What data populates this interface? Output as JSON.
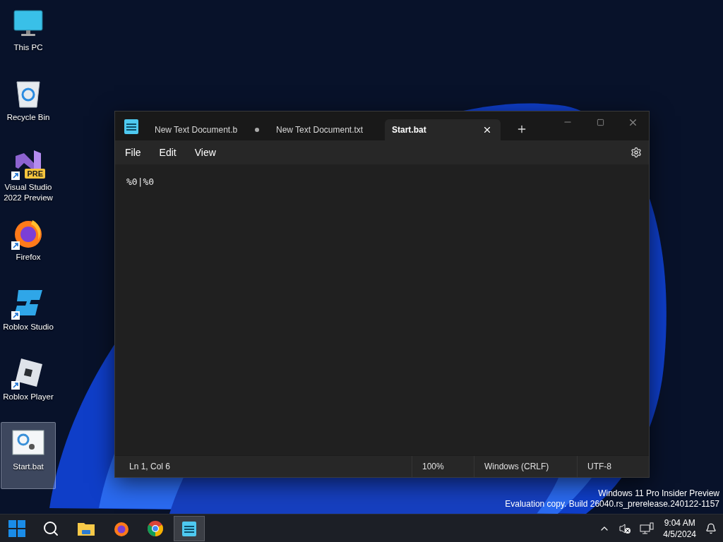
{
  "desktop_icons": [
    {
      "kind": "monitor",
      "label": "This PC",
      "selected": false
    },
    {
      "kind": "recycle-bin",
      "label": "Recycle Bin",
      "selected": false
    },
    {
      "kind": "visual-studio",
      "label": "Visual Studio 2022 Preview",
      "badge": "PRE",
      "shortcut": true,
      "selected": false
    },
    {
      "kind": "firefox",
      "label": "Firefox",
      "shortcut": true,
      "selected": false
    },
    {
      "kind": "roblox-studio",
      "label": "Roblox Studio",
      "shortcut": true,
      "selected": false
    },
    {
      "kind": "roblox-player",
      "label": "Roblox Player",
      "shortcut": true,
      "selected": false
    },
    {
      "kind": "batch-file",
      "label": "Start.bat",
      "selected": true
    }
  ],
  "window": {
    "tabs": [
      {
        "title": "New Text Document.b",
        "unsaved": true,
        "selected": false
      },
      {
        "title": "New Text Document.txt",
        "unsaved": false,
        "selected": false
      },
      {
        "title": "Start.bat",
        "unsaved": false,
        "selected": true
      }
    ],
    "menu": [
      "File",
      "Edit",
      "View"
    ],
    "content": "%0|%0",
    "status_bar": [
      "Ln 1, Col 6",
      "100%",
      "Windows (CRLF)",
      "UTF-8"
    ]
  },
  "watermark": [
    "Windows 11 Pro Insider Preview",
    "Evaluation copy. Build 26040.rs_prerelease.240122-1157"
  ],
  "taskbar": {
    "apps": [
      {
        "kind": "start",
        "selected": false
      },
      {
        "kind": "search",
        "selected": false
      },
      {
        "kind": "file-explorer",
        "selected": false
      },
      {
        "kind": "firefox",
        "selected": false
      },
      {
        "kind": "chrome",
        "selected": false
      },
      {
        "kind": "notepad",
        "selected": true
      }
    ],
    "time": "9:04 AM",
    "date": "4/5/2024"
  }
}
